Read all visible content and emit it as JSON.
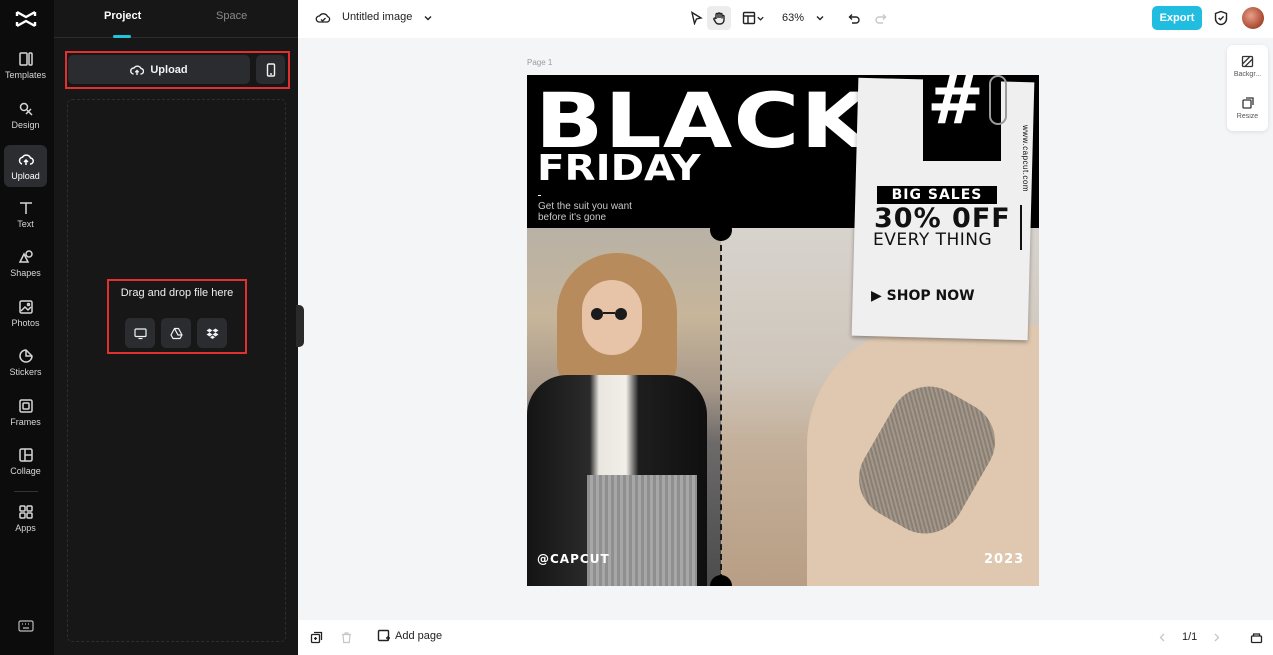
{
  "rail": {
    "items": [
      {
        "label": "Templates",
        "icon": "templates-icon"
      },
      {
        "label": "Design",
        "icon": "design-icon"
      },
      {
        "label": "Upload",
        "icon": "upload-icon"
      },
      {
        "label": "Text",
        "icon": "text-icon"
      },
      {
        "label": "Shapes",
        "icon": "shapes-icon"
      },
      {
        "label": "Photos",
        "icon": "photos-icon"
      },
      {
        "label": "Stickers",
        "icon": "stickers-icon"
      },
      {
        "label": "Frames",
        "icon": "frames-icon"
      },
      {
        "label": "Collage",
        "icon": "collage-icon"
      },
      {
        "label": "Apps",
        "icon": "apps-icon"
      }
    ],
    "active": "Upload"
  },
  "panel": {
    "tabs": [
      {
        "label": "Project"
      },
      {
        "label": "Space"
      }
    ],
    "active_tab": "Project",
    "upload_label": "Upload",
    "drop_text": "Drag and drop file here"
  },
  "topbar": {
    "title": "Untitled image",
    "zoom": "63%",
    "export_label": "Export"
  },
  "canvas": {
    "page_label": "Page 1",
    "design": {
      "headline": "BLACK",
      "subheadline": "FRIDAY",
      "tagline": "Get the suit you want\nbefore it's gone",
      "hash": "#",
      "website": "www.capcut.com",
      "big_sales": "BIG SALES",
      "offer": "30% 0FF",
      "offer_sub": "EVERY THING",
      "cta": "▶ SHOP NOW",
      "handle": "@CAPCUT",
      "year": "2023"
    }
  },
  "side_tools": [
    {
      "label": "Backgr...",
      "icon": "background-icon"
    },
    {
      "label": "Resize",
      "icon": "resize-icon"
    }
  ],
  "bottombar": {
    "add_page_label": "Add page",
    "page_count": "1/1"
  },
  "colors": {
    "accent": "#21bde0",
    "highlight_frame": "#e03030",
    "rail_bg": "#0c0c0c",
    "panel_bg": "#171717"
  }
}
